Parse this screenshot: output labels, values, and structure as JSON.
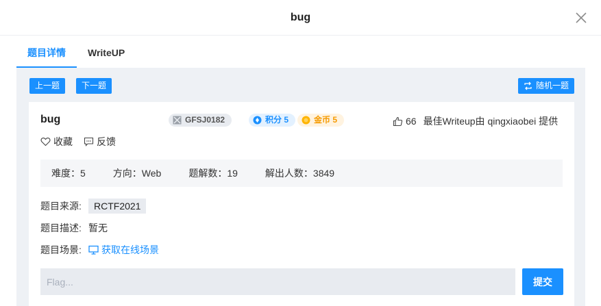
{
  "dialog": {
    "title": "bug"
  },
  "tabs": [
    {
      "label": "题目详情"
    },
    {
      "label": "WriteUP"
    }
  ],
  "nav": {
    "prev": "上一题",
    "next": "下一题",
    "random": "随机一题"
  },
  "challenge": {
    "name": "bug",
    "id": "GFSJ0182",
    "points_label": "积分 5",
    "coins_label": "金币 5",
    "likes": "66",
    "writeup_credit": "最佳Writeup由 qingxiaobei 提供",
    "favorite_label": "收藏",
    "feedback_label": "反馈"
  },
  "stats": {
    "difficulty": "难度：5",
    "direction": "方向：Web",
    "writeups": "题解数：19",
    "solvers": "解出人数：3849"
  },
  "info": {
    "source_label": "题目来源:",
    "source_value": "RCTF2021",
    "desc_label": "题目描述:",
    "desc_value": "暂无",
    "scene_label": "题目场景:",
    "scene_link": "获取在线场景"
  },
  "flag": {
    "placeholder": "Flag...",
    "value": "",
    "submit_label": "提交"
  },
  "colors": {
    "accent": "#1a90ff",
    "panel_bg": "#eef1f5",
    "points_badge": "#e3f1ff",
    "coins_badge": "#fff3e0"
  },
  "icons": [
    "close-icon",
    "random-icon",
    "id-icon",
    "points-icon",
    "coin-icon",
    "thumbs-up-icon",
    "heart-icon",
    "feedback-icon",
    "monitor-icon"
  ]
}
